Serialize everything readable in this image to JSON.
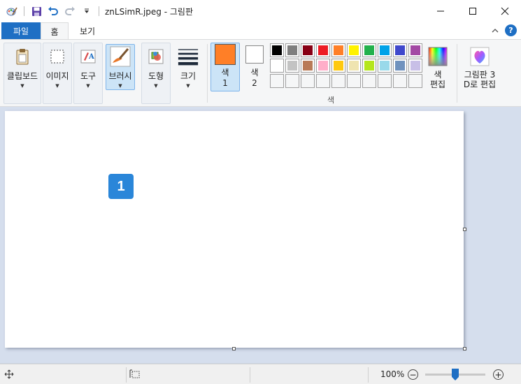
{
  "window": {
    "title": "znLSimR.jpeg - 그림판"
  },
  "tabs": {
    "file": "파일",
    "home": "홈",
    "view": "보기"
  },
  "help_label": "?",
  "ribbon": {
    "clipboard": "클립보드",
    "image": "이미지",
    "tools": "도구",
    "brushes": "브러시",
    "shapes": "도형",
    "size": "크기",
    "color1_line1": "색",
    "color1_line2": "1",
    "color2_line1": "색",
    "color2_line2": "2",
    "edit_colors_line1": "색",
    "edit_colors_line2": "편집",
    "paint3d_line1": "그림판 3",
    "paint3d_line2": "D로 편집",
    "colors_group": "색"
  },
  "colors": {
    "color1": "#ff7f27",
    "color2": "#ffffff",
    "accent": "#1e6fc4",
    "palette_row1": [
      "#000000",
      "#7f7f7f",
      "#880015",
      "#ed1c24",
      "#ff7f27",
      "#fff200",
      "#22b14c",
      "#00a2e8",
      "#3f48cc",
      "#a349a4"
    ],
    "palette_row2": [
      "#ffffff",
      "#c3c3c3",
      "#b97a57",
      "#ffaec9",
      "#ffc90e",
      "#efe4b0",
      "#b5e61d",
      "#99d9ea",
      "#7092be",
      "#c8bfe7"
    ],
    "palette_row3": [
      "#ffffff",
      "#ffffff",
      "#ffffff",
      "#ffffff",
      "#ffffff",
      "#ffffff",
      "#ffffff",
      "#ffffff",
      "#ffffff",
      "#ffffff"
    ]
  },
  "canvas": {
    "marker_label": "1"
  },
  "status": {
    "zoom": "100%",
    "zoom_out": "−",
    "zoom_in": "+"
  }
}
